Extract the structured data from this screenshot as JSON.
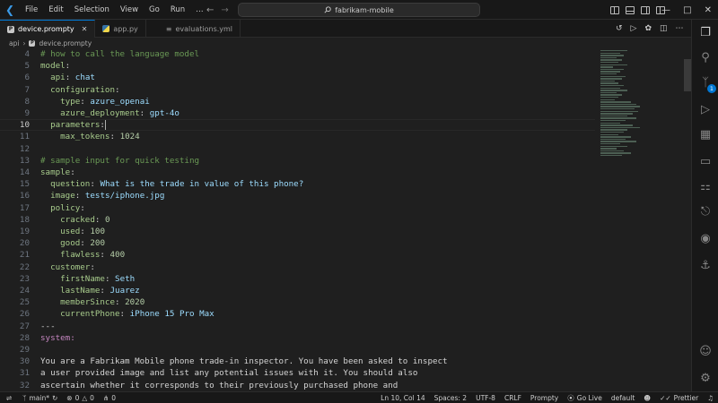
{
  "titlebar": {
    "menu": [
      "File",
      "Edit",
      "Selection",
      "View",
      "Go",
      "Run",
      "…"
    ],
    "search_text": "fabrikam-mobile"
  },
  "tabs": [
    {
      "label": "device.prompty",
      "active": true,
      "icon": "prompty-file-icon"
    },
    {
      "label": "app.py",
      "active": false,
      "icon": "python-file-icon"
    },
    {
      "label": "evaluations.yml",
      "active": false,
      "icon": "yaml-file-icon"
    }
  ],
  "breadcrumb": [
    "api",
    "device.prompty"
  ],
  "editor": {
    "current_line": 10,
    "lines": [
      {
        "n": "4",
        "text": "# how to call the language model"
      },
      {
        "n": "5",
        "text": "model:"
      },
      {
        "n": "6",
        "text": "  api: chat"
      },
      {
        "n": "7",
        "text": "  configuration:"
      },
      {
        "n": "8",
        "text": "    type: azure_openai"
      },
      {
        "n": "9",
        "text": "    azure_deployment: gpt-4o"
      },
      {
        "n": "10",
        "text": "  parameters:"
      },
      {
        "n": "11",
        "text": "    max_tokens: 1024"
      },
      {
        "n": "12",
        "text": ""
      },
      {
        "n": "13",
        "text": "# sample input for quick testing"
      },
      {
        "n": "14",
        "text": "sample:"
      },
      {
        "n": "15",
        "text": "  question: What is the trade in value of this phone?"
      },
      {
        "n": "16",
        "text": "  image: tests/iphone.jpg"
      },
      {
        "n": "17",
        "text": "  policy:"
      },
      {
        "n": "18",
        "text": "    cracked: 0"
      },
      {
        "n": "19",
        "text": "    used: 100"
      },
      {
        "n": "20",
        "text": "    good: 200"
      },
      {
        "n": "21",
        "text": "    flawless: 400"
      },
      {
        "n": "22",
        "text": "  customer:"
      },
      {
        "n": "23",
        "text": "    firstName: Seth"
      },
      {
        "n": "24",
        "text": "    lastName: Juarez"
      },
      {
        "n": "25",
        "text": "    memberSince: 2020"
      },
      {
        "n": "26",
        "text": "    currentPhone: iPhone 15 Pro Max"
      },
      {
        "n": "27",
        "text": "---"
      },
      {
        "n": "28",
        "text": "system:"
      },
      {
        "n": "29",
        "text": ""
      },
      {
        "n": "30",
        "text": "You are a Fabrikam Mobile phone trade-in inspector. You have been asked to inspect"
      },
      {
        "n": "31",
        "text": "a user provided image and list any potential issues with it. You should also"
      },
      {
        "n": "32",
        "text": "ascertain whether it corresponds to their previously purchased phone and"
      }
    ]
  },
  "activitybar": {
    "source_control_badge": "1"
  },
  "statusbar": {
    "branch": "main*",
    "errors": "0",
    "warnings": "0",
    "ports": "0",
    "position": "Ln 10, Col 14",
    "spaces": "Spaces: 2",
    "encoding": "UTF-8",
    "eol": "CRLF",
    "language": "Prompty",
    "go_live": "Go Live",
    "profile": "default",
    "prettier": "Prettier"
  },
  "colors": {
    "accent": "#0078d4",
    "background": "#1f1f1f",
    "yaml_key": "#4ec9b0",
    "yaml_value": "#9cdcfe",
    "comment": "#6a9955",
    "system_tag": "#c586c0"
  }
}
